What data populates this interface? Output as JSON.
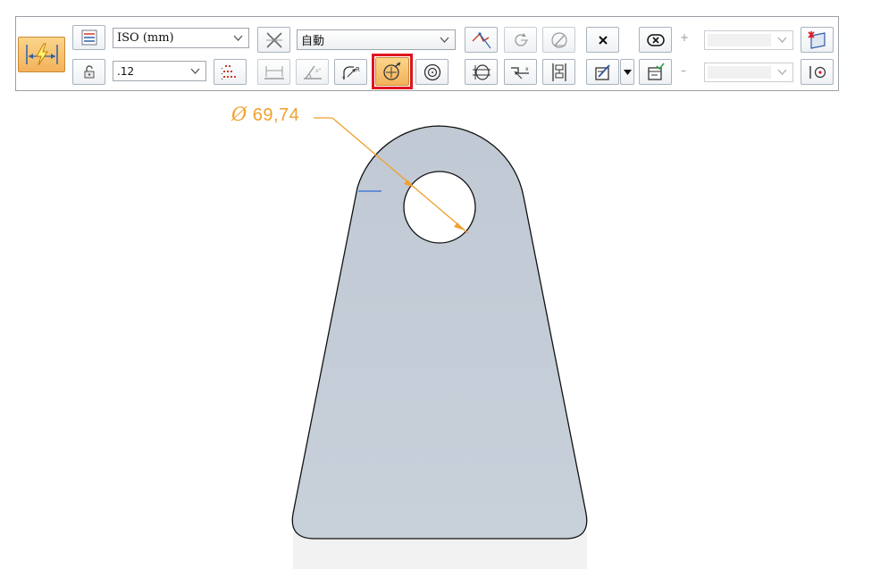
{
  "toolbar": {
    "standard_combo": {
      "value": "ISO (mm)"
    },
    "precision_combo": {
      "value": ".12"
    },
    "mode_combo": {
      "value": "自動"
    },
    "plus_sign": "+",
    "minus_sign": "–",
    "highlight_color": "#e0141e",
    "active_button_color": "#f7c86a",
    "icons": [
      "smart-dimension-icon",
      "dimension-style-icon",
      "lock-icon",
      "precision-icon",
      "cross-out-icon",
      "distance-between-icon",
      "angle-between-icon",
      "radius-icon",
      "diameter-icon",
      "concentric-icon",
      "symmetric-icon",
      "rotate-icon",
      "angle-icon",
      "close-icon",
      "ex-icon",
      "coordinate-icon",
      "jog-icon",
      "stack-icon",
      "edit-icon",
      "dropdown-arrow-icon",
      "list-check-icon",
      "sketch-plane-icon",
      "point-icon"
    ]
  },
  "drawing": {
    "dimension_label": "69,74",
    "dimension_symbol": "Ø",
    "part_fill": "#c3ccd7",
    "dimension_color": "#f0a030"
  }
}
